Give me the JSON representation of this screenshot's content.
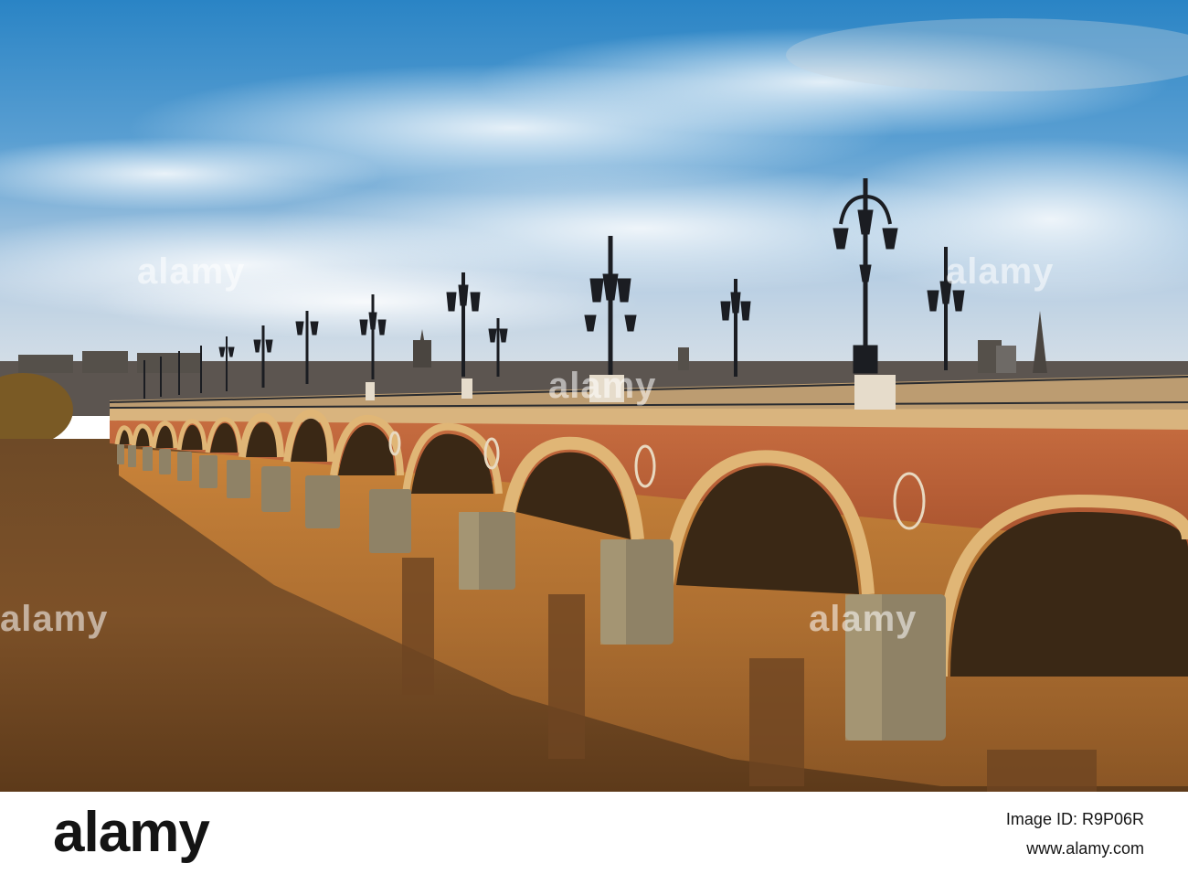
{
  "photo": {
    "subject": "Pont de Pierre",
    "colors": {
      "sky_top": "#2b86c6",
      "sky_mid": "#6fa9d4",
      "sky_low": "#cfdbe6",
      "brick": "#b8603a",
      "stone": "#e2b97a",
      "river": "#7a4f24",
      "river_reflection": "#c77a35",
      "lamp": "#1b1d22"
    }
  },
  "watermark": {
    "text": "alamy"
  },
  "footer": {
    "logo_text": "alamy",
    "image_id": "Image ID: R9P06R",
    "url": "www.alamy.com"
  }
}
